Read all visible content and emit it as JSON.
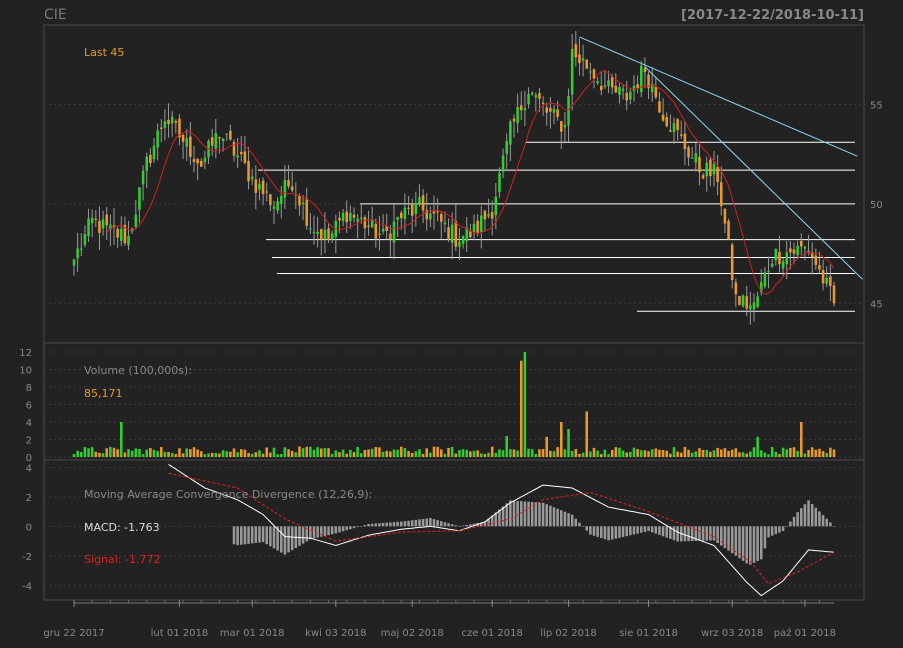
{
  "header": {
    "symbol": "CIE",
    "date_range": "[2017-12-22/2018-10-11]"
  },
  "colors": {
    "background": "#222222",
    "panel_border": "#4a4a4a",
    "grid": "#3a3a3a",
    "text": "#888888",
    "up": "#33cc33",
    "down": "#e89a2b",
    "wick": "#999999",
    "sma": "#cc2222",
    "support_line": "#ffffff",
    "trend_line": "#8fd8ef",
    "last_label": "#e89a2b",
    "macd_line": "#ffffff",
    "signal_line": "#dd2222",
    "hist": "#999999"
  },
  "price_panel": {
    "last_label": "Last 45",
    "y_ticks": [
      "45",
      "50",
      "55"
    ],
    "support_lines": [
      44.6,
      46.5,
      47.3,
      48.2,
      50.0,
      51.7,
      53.1
    ],
    "trend_lines": [
      {
        "from": {
          "date": "2018-07-05",
          "value": 58.4
        },
        "to": {
          "date": "2018-10-20",
          "value": 52.4
        }
      },
      {
        "from": {
          "date": "2018-07-31",
          "value": 56.9
        },
        "to": {
          "date": "2018-10-22",
          "value": 46.2
        }
      }
    ]
  },
  "volume_panel": {
    "label": "Volume (100,000s):",
    "last_value": "85,171",
    "y_ticks": [
      "0",
      "2",
      "4",
      "6",
      "8",
      "10",
      "12"
    ]
  },
  "macd_panel": {
    "label": "Moving Average Convergence Divergence (12,26,9):",
    "macd_label": "MACD: -1.763",
    "signal_label": "Signal: -1.772",
    "y_ticks": [
      "-4",
      "-2",
      "0",
      "2",
      "4"
    ]
  },
  "x_axis": {
    "labels": [
      "gru 22 2017",
      "lut 01 2018",
      "mar 01 2018",
      "kwi 03 2018",
      "maj 02 2018",
      "cze 01 2018",
      "lip 02 2018",
      "sie 01 2018",
      "wrz 03 2018",
      "paź 01 2018"
    ]
  },
  "chart_data": {
    "type": "candlestick",
    "title": "CIE",
    "date_range": "2017-12-22 / 2018-10-11",
    "x_axis_labels": [
      "gru 22 2017",
      "lut 01 2018",
      "mar 01 2018",
      "kwi 03 2018",
      "maj 02 2018",
      "cze 01 2018",
      "lip 02 2018",
      "sie 01 2018",
      "wrz 03 2018",
      "paź 01 2018"
    ],
    "price": {
      "ylim": [
        43,
        59
      ],
      "sma_period": 10,
      "last": 45,
      "close_keypoints": [
        [
          "2017-12-22",
          47.2
        ],
        [
          "2017-12-29",
          49.1
        ],
        [
          "2018-01-05",
          48.6
        ],
        [
          "2018-01-12",
          48.3
        ],
        [
          "2018-01-19",
          52.0
        ],
        [
          "2018-01-26",
          54.4
        ],
        [
          "2018-02-02",
          53.2
        ],
        [
          "2018-02-09",
          52.0
        ],
        [
          "2018-02-16",
          53.6
        ],
        [
          "2018-02-23",
          52.4
        ],
        [
          "2018-03-02",
          51.0
        ],
        [
          "2018-03-09",
          50.0
        ],
        [
          "2018-03-16",
          51.2
        ],
        [
          "2018-03-23",
          49.0
        ],
        [
          "2018-03-30",
          48.2
        ],
        [
          "2018-04-06",
          49.6
        ],
        [
          "2018-04-13",
          49.0
        ],
        [
          "2018-04-20",
          48.3
        ],
        [
          "2018-04-27",
          49.4
        ],
        [
          "2018-05-04",
          49.8
        ],
        [
          "2018-05-11",
          49.2
        ],
        [
          "2018-05-18",
          48.3
        ],
        [
          "2018-05-25",
          48.6
        ],
        [
          "2018-06-01",
          49.8
        ],
        [
          "2018-06-08",
          53.6
        ],
        [
          "2018-06-15",
          55.8
        ],
        [
          "2018-06-22",
          54.6
        ],
        [
          "2018-06-29",
          53.9
        ],
        [
          "2018-07-03",
          57.6
        ],
        [
          "2018-07-10",
          56.8
        ],
        [
          "2018-07-17",
          55.7
        ],
        [
          "2018-07-24",
          55.4
        ],
        [
          "2018-07-31",
          56.8
        ],
        [
          "2018-08-07",
          54.6
        ],
        [
          "2018-08-14",
          53.2
        ],
        [
          "2018-08-21",
          51.8
        ],
        [
          "2018-08-28",
          51.4
        ],
        [
          "2018-09-04",
          45.2
        ],
        [
          "2018-09-11",
          44.8
        ],
        [
          "2018-09-18",
          47.4
        ],
        [
          "2018-09-25",
          47.6
        ],
        [
          "2018-10-02",
          47.8
        ],
        [
          "2018-10-11",
          45.0
        ]
      ]
    },
    "volume": {
      "unit": "100,000s",
      "ylim": [
        0,
        12
      ],
      "last": "85,171",
      "spikes": [
        [
          "2018-01-10",
          4.0
        ],
        [
          "2018-06-07",
          2.4
        ],
        [
          "2018-06-13",
          11.0
        ],
        [
          "2018-06-14",
          12.0
        ],
        [
          "2018-06-22",
          2.3
        ],
        [
          "2018-06-28",
          4.0
        ],
        [
          "2018-07-02",
          3.2
        ],
        [
          "2018-07-09",
          5.2
        ],
        [
          "2018-09-28",
          4.0
        ],
        [
          "2018-09-12",
          2.3
        ]
      ]
    },
    "macd": {
      "params": "12,26,9",
      "ylim": [
        -5,
        4.5
      ],
      "last_macd": -1.763,
      "last_signal": -1.772,
      "macd_keypoints": [
        [
          "2018-01-29",
          4.2
        ],
        [
          "2018-02-12",
          2.6
        ],
        [
          "2018-02-23",
          1.8
        ],
        [
          "2018-03-06",
          0.8
        ],
        [
          "2018-03-14",
          -0.7
        ],
        [
          "2018-03-23",
          -0.8
        ],
        [
          "2018-04-03",
          -1.3
        ],
        [
          "2018-04-16",
          -0.6
        ],
        [
          "2018-04-27",
          -0.2
        ],
        [
          "2018-05-09",
          0.0
        ],
        [
          "2018-05-21",
          -0.3
        ],
        [
          "2018-05-30",
          0.3
        ],
        [
          "2018-06-08",
          1.6
        ],
        [
          "2018-06-21",
          2.8
        ],
        [
          "2018-07-03",
          2.6
        ],
        [
          "2018-07-17",
          1.3
        ],
        [
          "2018-08-01",
          0.8
        ],
        [
          "2018-08-13",
          -0.4
        ],
        [
          "2018-08-27",
          -1.3
        ],
        [
          "2018-09-07",
          -3.8
        ],
        [
          "2018-09-13",
          -4.7
        ],
        [
          "2018-09-21",
          -3.7
        ],
        [
          "2018-10-02",
          -1.6
        ],
        [
          "2018-10-11",
          -1.76
        ]
      ],
      "signal_keypoints": [
        [
          "2018-01-29",
          3.6
        ],
        [
          "2018-02-23",
          2.6
        ],
        [
          "2018-03-14",
          0.5
        ],
        [
          "2018-04-03",
          -1.0
        ],
        [
          "2018-04-27",
          -0.4
        ],
        [
          "2018-05-21",
          -0.3
        ],
        [
          "2018-06-08",
          0.5
        ],
        [
          "2018-06-21",
          1.8
        ],
        [
          "2018-07-10",
          2.3
        ],
        [
          "2018-08-01",
          1.0
        ],
        [
          "2018-08-27",
          -0.7
        ],
        [
          "2018-09-10",
          -2.4
        ],
        [
          "2018-09-17",
          -3.9
        ],
        [
          "2018-09-27",
          -3.1
        ],
        [
          "2018-10-11",
          -1.77
        ]
      ]
    }
  }
}
